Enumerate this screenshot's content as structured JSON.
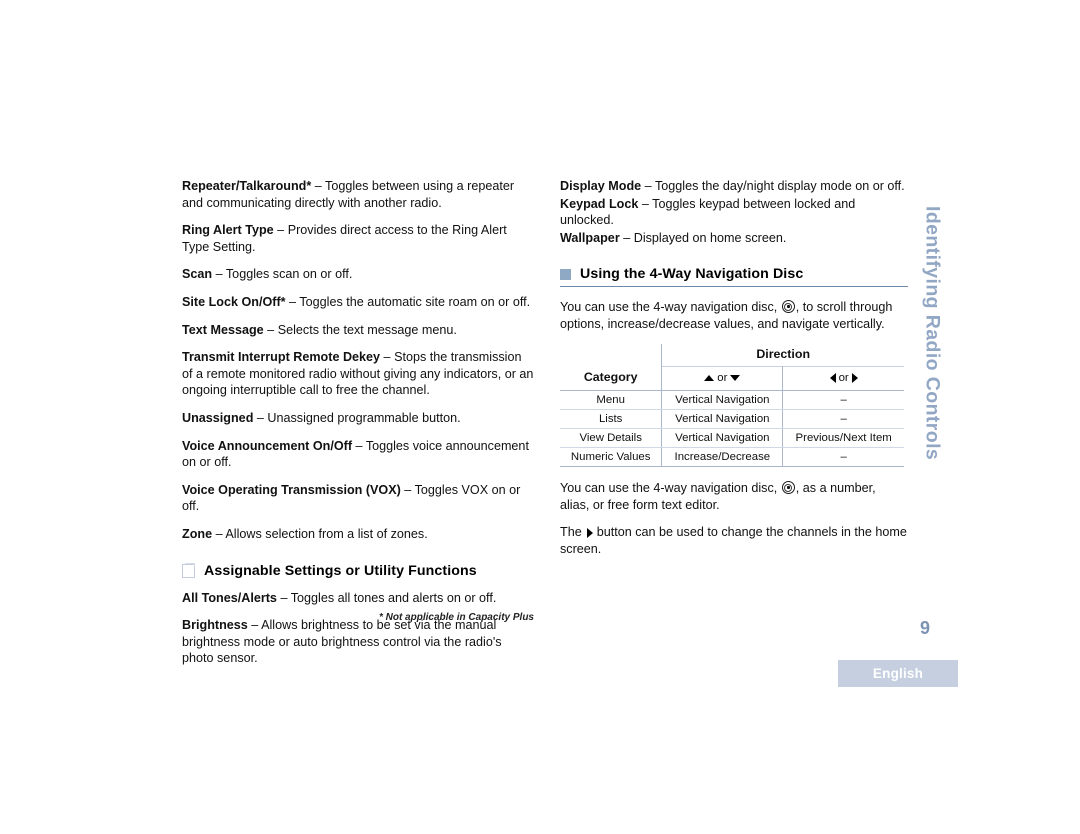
{
  "document": {
    "page_number": "9",
    "language_badge": "English",
    "side_tab": "Identifying Radio Controls",
    "footnote": "* Not applicable in Capacity Plus",
    "accent_color": "#8fa8c4",
    "side_tab_color": "#92a7c4",
    "badge_bg_color": "#c5cfe0"
  },
  "left_column": {
    "entries": [
      {
        "term": "Repeater/Talkaround*",
        "dash": " – ",
        "description": "Toggles between using a repeater and communicating directly with another radio."
      },
      {
        "term": "Ring Alert Type",
        "dash": " – ",
        "description": "Provides direct access to the Ring Alert Type Setting."
      },
      {
        "term": "Scan",
        "dash": " – ",
        "description": "Toggles scan on or off."
      },
      {
        "term": "Site Lock On/Off*",
        "dash": " – ",
        "description": "Toggles the automatic site roam on or off."
      },
      {
        "term": "Text Message",
        "dash": " – ",
        "description": "Selects the text message menu."
      },
      {
        "term": "Transmit Interrupt Remote Dekey",
        "dash": " – ",
        "description": "Stops the transmission of a remote monitored radio without giving any indicators, or an ongoing interruptible call to free the channel."
      },
      {
        "term": "Unassigned",
        "dash": " – ",
        "description": "Unassigned programmable button."
      },
      {
        "term": "Voice Announcement On/Off",
        "dash": " – ",
        "description": "Toggles voice announcement on or off."
      },
      {
        "term": "Voice Operating Transmission (VOX)",
        "dash": " – ",
        "description": "Toggles VOX on or off."
      },
      {
        "term": "Zone",
        "dash": " – ",
        "description": "Allows selection from a list of zones."
      }
    ],
    "section_heading": "Assignable Settings or Utility Functions",
    "section_entries": [
      {
        "term": "All Tones/Alerts",
        "dash": " – ",
        "description": "Toggles all tones and alerts on or off."
      },
      {
        "term": "Brightness",
        "dash": " – ",
        "description": "Allows brightness to be set via the manual brightness mode or auto brightness control via the radio's photo sensor."
      }
    ]
  },
  "right_column": {
    "entries": [
      {
        "term": "Display Mode",
        "dash": " – ",
        "description": "Toggles the day/night display mode on or off."
      },
      {
        "term": "Keypad Lock",
        "dash": " – ",
        "description": "Toggles keypad between locked and unlocked."
      },
      {
        "term": "Wallpaper",
        "dash": " – ",
        "description": "Displayed on home screen."
      }
    ],
    "section_heading": "Using the 4-Way Navigation Disc",
    "intro_before_icon": "You can use the 4-way navigation disc, ",
    "intro_after_icon": ", to scroll through options, increase/decrease values, and navigate vertically.",
    "after_before_icon": "You can use the 4-way navigation disc, ",
    "after_after_icon": ", as a number, alias, or free form text editor.",
    "closing_before_arrow": "The ",
    "closing_after_arrow": " button can be used to change the channels in the home screen."
  },
  "table": {
    "header_direction": "Direction",
    "header_category": "Category",
    "header_vertical_or": "or",
    "header_horizontal_or": "or",
    "rows": [
      {
        "category": "Menu",
        "vertical": "Vertical Navigation",
        "horizontal": "–"
      },
      {
        "category": "Lists",
        "vertical": "Vertical Navigation",
        "horizontal": "–"
      },
      {
        "category": "View Details",
        "vertical": "Vertical Navigation",
        "horizontal": "Previous/Next Item"
      },
      {
        "category": "Numeric Values",
        "vertical": "Increase/Decrease",
        "horizontal": "–"
      }
    ]
  }
}
